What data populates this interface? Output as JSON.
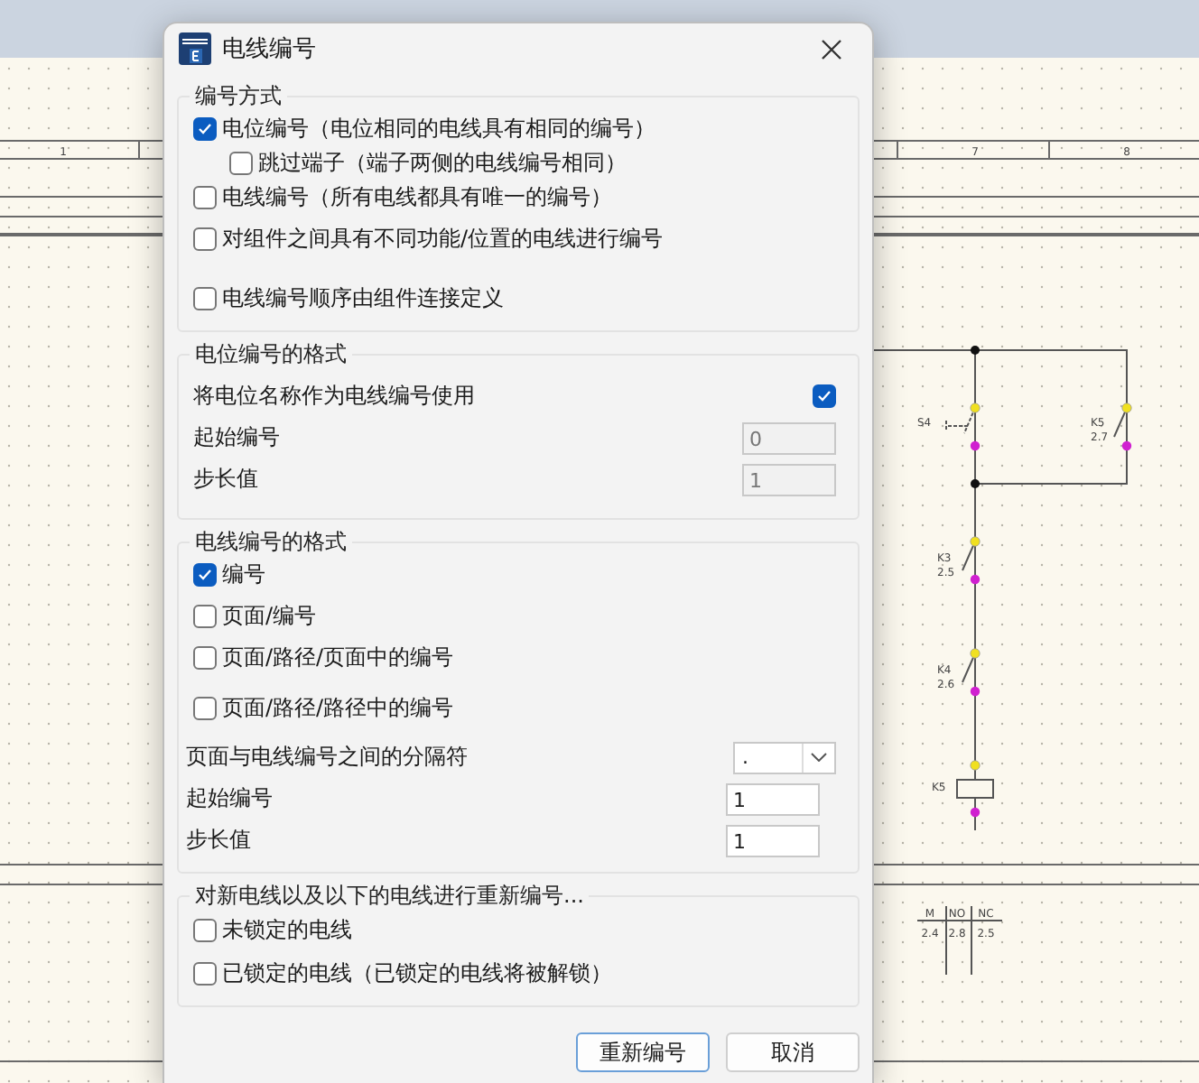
{
  "window": {
    "title": "电线编号"
  },
  "numbering_method": {
    "title": "编号方式",
    "options": [
      {
        "label": "电位编号（电位相同的电线具有相同的编号）",
        "checked": true,
        "children": [
          {
            "label": "跳过端子（端子两侧的电线编号相同）",
            "checked": false
          }
        ]
      },
      {
        "label": "电线编号（所有电线都具有唯一的编号）",
        "checked": false
      },
      {
        "label": "对组件之间具有不同功能/位置的电线进行编号",
        "checked": false
      },
      {
        "label": "电线编号顺序由组件连接定义",
        "checked": false
      }
    ]
  },
  "potential_format": {
    "title": "电位编号的格式",
    "use_potential_name": {
      "label": "将电位名称作为电线编号使用",
      "checked": true
    },
    "fields": [
      {
        "label": "起始编号",
        "value": "0",
        "disabled": true
      },
      {
        "label": "步长值",
        "value": "1",
        "disabled": true
      }
    ]
  },
  "wire_format": {
    "title": "电线编号的格式",
    "options": [
      {
        "label": "编号",
        "checked": true
      },
      {
        "label": "页面/编号",
        "checked": false
      },
      {
        "label": "页面/路径/页面中的编号",
        "checked": false
      },
      {
        "label": "页面/路径/路径中的编号",
        "checked": false
      }
    ],
    "separator": {
      "label": "页面与电线编号之间的分隔符",
      "value": "."
    },
    "fields": [
      {
        "label": "起始编号",
        "value": "1",
        "disabled": false
      },
      {
        "label": "步长值",
        "value": "1",
        "disabled": false
      }
    ]
  },
  "renumber": {
    "title": "对新电线以及以下的电线进行重新编号...",
    "options": [
      {
        "label": "未锁定的电线",
        "checked": false
      },
      {
        "label": "已锁定的电线（已锁定的电线将被解锁）",
        "checked": false
      }
    ]
  },
  "buttons": [
    {
      "label": "重新编号",
      "default": true
    },
    {
      "label": "取消",
      "default": false
    }
  ],
  "schematic": {
    "columns": [
      "1",
      "7",
      "8"
    ],
    "devices": [
      {
        "kind": "pushbutton",
        "name": "S4"
      },
      {
        "kind": "contact",
        "name": "K5",
        "ref": "2.7"
      },
      {
        "kind": "contact",
        "name": "K3",
        "ref": "2.5"
      },
      {
        "kind": "contact",
        "name": "K4",
        "ref": "2.6"
      },
      {
        "kind": "coil",
        "name": "K5"
      }
    ],
    "contact_table": {
      "headers": [
        "M",
        "NO",
        "NC"
      ],
      "values": [
        "2.4",
        "2.8",
        "2.5"
      ]
    }
  }
}
